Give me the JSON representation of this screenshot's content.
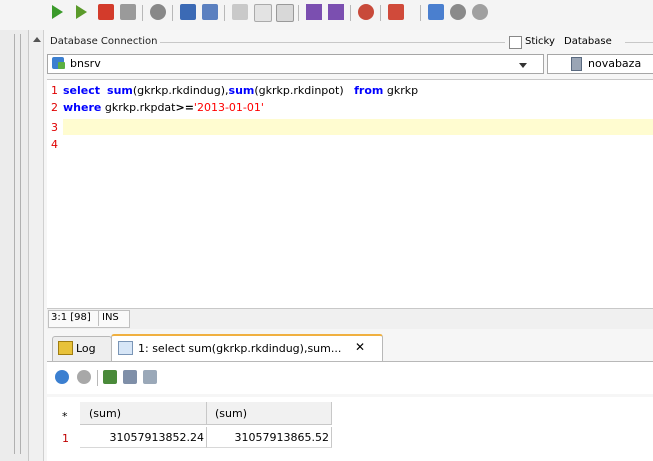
{
  "toolbar": {
    "icons": [
      "run-icon",
      "run-step-icon",
      "run-script-icon",
      "stop-icon",
      "commit-icon",
      "save-icon",
      "save-as-icon",
      "cut-icon",
      "copy-icon",
      "paste-icon",
      "back-icon",
      "forward-icon",
      "debug-icon",
      "export-icon",
      "dropdown-arrow-icon",
      "grid-icon",
      "db-icon",
      "db2-icon"
    ]
  },
  "connection": {
    "label": "Database Connection",
    "sticky_label": "Sticky",
    "database_label": "Database",
    "selected": "bnsrv",
    "database": "novabaza"
  },
  "editor": {
    "line_numbers": [
      "1",
      "2",
      "3",
      "4"
    ],
    "line1": {
      "kw_select": "select",
      "sum1": "sum",
      "arg1": "(gkrkp.rkdindug),",
      "sum2": "sum",
      "arg2": "(gkrkp.rkdinpot)",
      "kw_from": "from",
      "table": " gkrkp"
    },
    "line2": {
      "kw_where": "where",
      "cond": " gkrkp.rkpdat",
      "op": ">=",
      "value": "'2013-01-01'"
    }
  },
  "status": {
    "position": "3:1 [98]",
    "mode": "INS"
  },
  "tabs": {
    "log_label": "Log",
    "result_label": "1: select sum(gkrkp.rkdindug),sum...",
    "close": "✕"
  },
  "result_toolbar": {
    "icons": [
      "refresh-icon",
      "stop-icon",
      "export-icon",
      "edit-icon",
      "filter-icon"
    ]
  },
  "grid": {
    "corner": "*",
    "columns": [
      "(sum)",
      "(sum)"
    ],
    "rows": [
      {
        "num": "1",
        "values": [
          "31057913852.24",
          "31057913865.52"
        ]
      }
    ]
  },
  "colors": {
    "keyword": "#0000ff",
    "string": "#ff0000",
    "current_line": "#fffcd0",
    "tab_accent": "#f0b040"
  }
}
